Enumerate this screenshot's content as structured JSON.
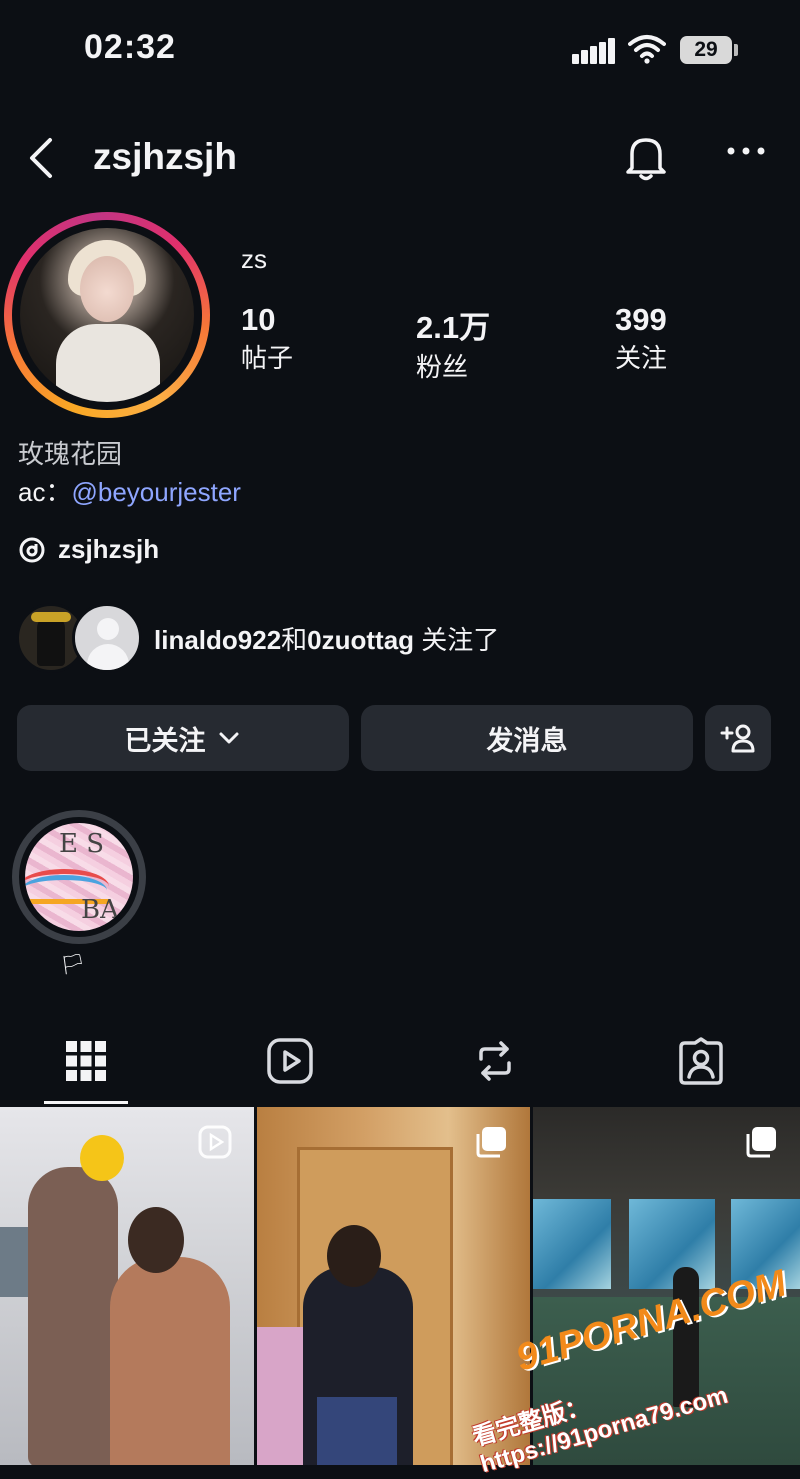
{
  "status_bar": {
    "time": "02:32",
    "battery": "29"
  },
  "header": {
    "username": "zsjhzsjh"
  },
  "profile": {
    "display_name": "zs",
    "stats": [
      {
        "value": "10",
        "label": "帖子"
      },
      {
        "value": "2.1万",
        "label": "粉丝"
      },
      {
        "value": "399",
        "label": "关注"
      }
    ],
    "bio_line1": "玫瑰花园",
    "bio_line2_prefix": "ac：",
    "bio_mention": "@beyourjester",
    "threads_handle": "zsjhzsjh"
  },
  "followed_by": {
    "user1": "linaldo922",
    "connector": "和",
    "user2": "0zuottag",
    "suffix": "关注了"
  },
  "buttons": {
    "following": "已关注",
    "message": "发消息"
  },
  "highlight": {
    "label": "🏳"
  },
  "highlight_image_text": {
    "t1": "E S",
    "t2": "BA"
  },
  "tabs": [
    {
      "icon": "grid-icon",
      "active": true
    },
    {
      "icon": "reels-icon",
      "active": false
    },
    {
      "icon": "repost-icon",
      "active": false
    },
    {
      "icon": "tagged-icon",
      "active": false
    }
  ],
  "watermark": {
    "line1": "91PORNA.COM",
    "line2": "看完整版：https://91porna79.com"
  },
  "colors": {
    "background": "#0c0f14",
    "button": "#262a31",
    "mention": "#8fa6ff"
  }
}
